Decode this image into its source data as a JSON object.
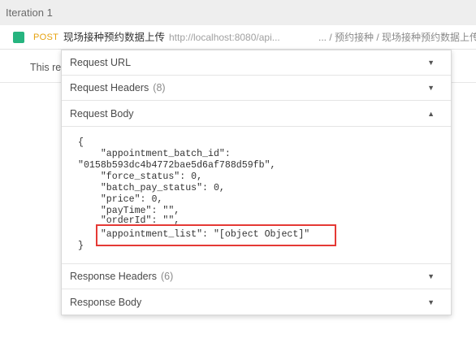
{
  "iteration": {
    "label": "Iteration 1"
  },
  "request": {
    "method": "POST",
    "name": "现场接种预约数据上传",
    "url": "http://localhost:8080/api...",
    "path": "... / 预约接种 / 现场接种预约数据上传",
    "status_color": "#26b47f"
  },
  "result": {
    "text": "This re"
  },
  "sections": {
    "request_url": {
      "label": "Request URL",
      "caret": "▼"
    },
    "request_headers": {
      "label": "Request Headers",
      "count": "(8)",
      "caret": "▼"
    },
    "request_body": {
      "label": "Request Body",
      "caret": "▲",
      "lines": [
        "{",
        "    \"appointment_batch_id\":",
        "\"0158b593dc4b4772bae5d6af788d59fb\",",
        "    \"force_status\": 0,",
        "    \"batch_pay_status\": 0,",
        "    \"price\": 0,",
        "    \"payTime\": \"\",",
        "    \"orderId\": \"\",",
        "    \"appointment_list\": \"[object Object]\"",
        "}"
      ]
    },
    "response_headers": {
      "label": "Response Headers",
      "count": "(6)",
      "caret": "▼"
    },
    "response_body": {
      "label": "Response Body",
      "caret": "▼"
    }
  },
  "colors": {
    "highlight": "#e53935",
    "method": "#e6a20f"
  }
}
